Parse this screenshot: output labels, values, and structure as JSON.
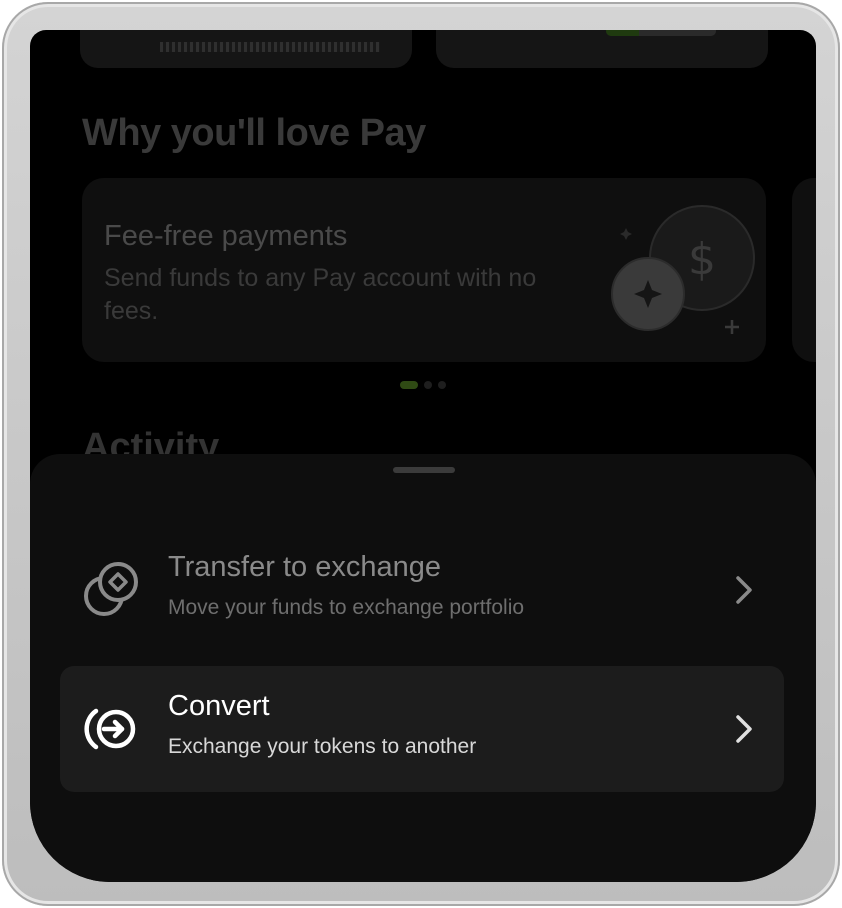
{
  "background": {
    "section_title": "Why you'll love Pay",
    "feature_card": {
      "title": "Fee-free payments",
      "description": "Send funds to any Pay account with no fees."
    },
    "activity_title": "Activity"
  },
  "sheet": {
    "options": [
      {
        "title": "Transfer to exchange",
        "subtitle": "Move your funds to exchange portfolio",
        "icon": "transfer-coins-icon"
      },
      {
        "title": "Convert",
        "subtitle": "Exchange your tokens to another",
        "icon": "convert-icon"
      }
    ]
  },
  "colors": {
    "accent": "#2f4a14",
    "sheet_bg": "#0e0e0e",
    "selected_row_bg": "#1c1c1c"
  }
}
